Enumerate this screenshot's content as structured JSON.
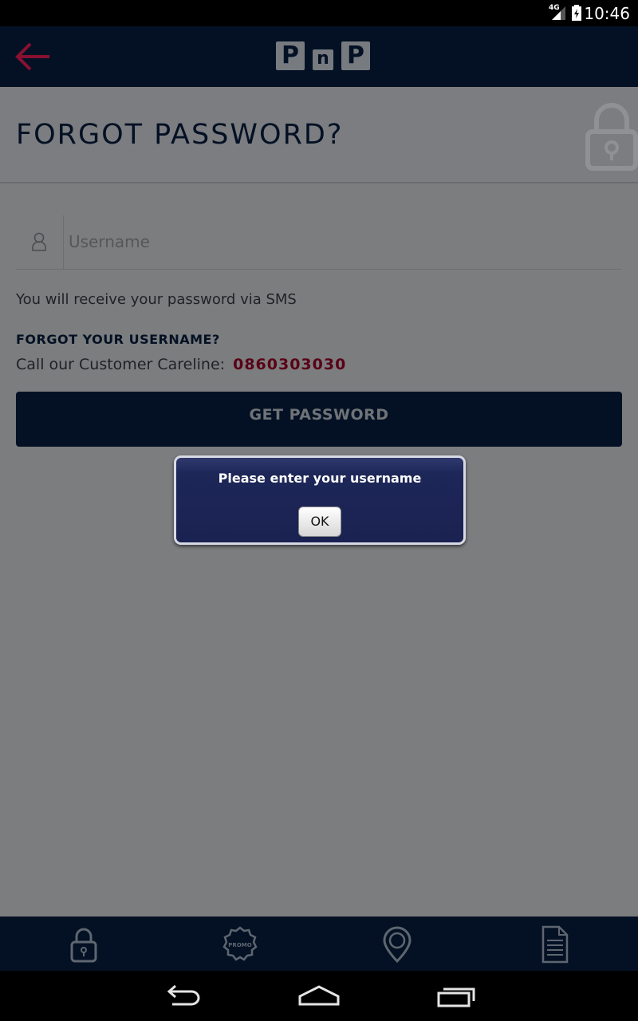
{
  "status_bar": {
    "network": "4G",
    "time": "10:46"
  },
  "header": {
    "logo": [
      "P",
      "n",
      "P"
    ]
  },
  "page": {
    "title": "FORGOT PASSWORD?"
  },
  "form": {
    "username_placeholder": "Username",
    "username_value": "",
    "info_text": "You will receive your password via SMS",
    "forgot_username_heading": "FORGOT YOUR USERNAME?",
    "careline_label": "Call our Customer Careline:",
    "careline_number": "0860303030",
    "submit_label": "GET PASSWORD"
  },
  "dialog": {
    "message": "Please enter your username",
    "ok_label": "OK"
  },
  "tabbar": {
    "tabs": [
      {
        "icon": "lock-icon"
      },
      {
        "icon": "promo-badge-icon",
        "badge_text": "PROMO"
      },
      {
        "icon": "location-pin-icon"
      },
      {
        "icon": "document-icon"
      }
    ]
  },
  "colors": {
    "header_bg": "#041124",
    "accent_red": "#8a1031",
    "phone_color": "#5a0017"
  }
}
